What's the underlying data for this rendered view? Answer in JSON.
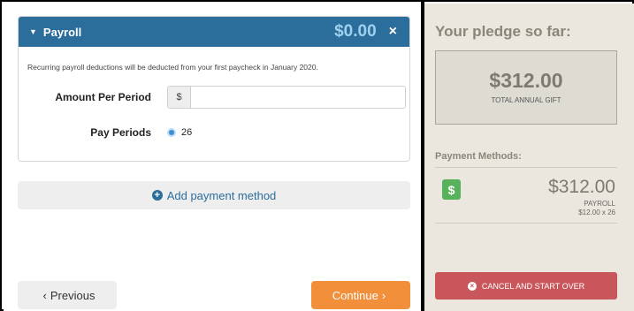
{
  "payroll": {
    "title": "Payroll",
    "amount": "$0.00",
    "close_glyph": "×",
    "note": "Recurring payroll deductions will be deducted from your first paycheck in January 2020.",
    "amount_label": "Amount Per Period",
    "currency_prefix": "$",
    "amount_value": "",
    "periods_label": "Pay Periods",
    "periods_value": "26"
  },
  "actions": {
    "add_method": "Add payment method",
    "previous": "Previous",
    "continue": "Continue"
  },
  "summary": {
    "title": "Your pledge so far:",
    "total_amount": "$312.00",
    "total_label": "TOTAL ANNUAL GIFT",
    "methods_title": "Payment Methods:",
    "method": {
      "icon": "dollar-icon",
      "badge_glyph": "$",
      "amount": "$312.00",
      "type": "PAYROLL",
      "calc": "$12.00 x 26"
    },
    "cancel": "CANCEL AND START OVER"
  },
  "colors": {
    "header_blue": "#2b6e9b",
    "continue_orange": "#f28f3b",
    "cancel_red": "#c9565a",
    "badge_green": "#58b15b",
    "summary_bg": "#ebe7de"
  }
}
